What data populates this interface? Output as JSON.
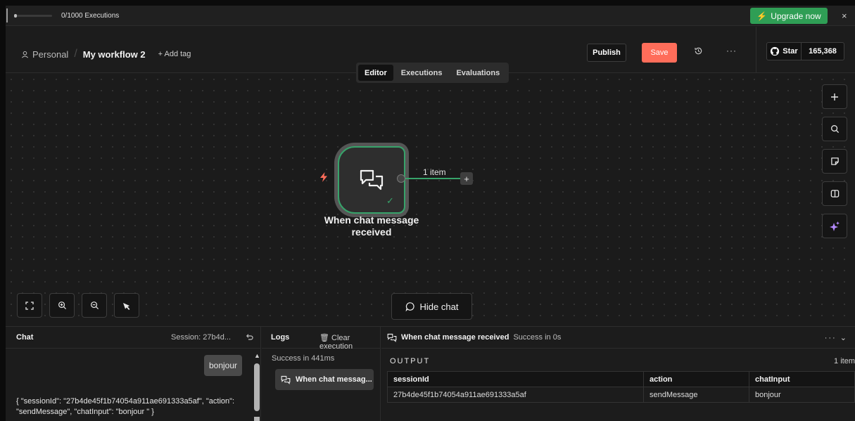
{
  "banner": {
    "executions": "0/1000 Executions",
    "upgrade_label": "Upgrade now",
    "close": "×"
  },
  "header": {
    "project": "Personal",
    "separator": "/",
    "workflow_name": "My workflow 2",
    "add_tag": "+ Add tag",
    "publish_label": "Publish",
    "save_label": "Save",
    "more": "···",
    "github_star_label": "Star",
    "github_star_count": "165,368"
  },
  "tabs": [
    {
      "label": "Editor",
      "active": true
    },
    {
      "label": "Executions",
      "active": false
    },
    {
      "label": "Evaluations",
      "active": false
    }
  ],
  "canvas": {
    "node_title": "When chat message received",
    "edge_label": "1 item",
    "hide_chat_label": "Hide chat",
    "right_tools": [
      "plus-icon",
      "search-icon",
      "sticky-note-icon",
      "panel-icon",
      "ai-sparkle-icon"
    ],
    "left_tools": [
      "fit-view-icon",
      "zoom-in-icon",
      "zoom-out-icon",
      "tidy-up-icon"
    ]
  },
  "chat": {
    "title": "Chat",
    "session": "Session: 27b4d...",
    "user_message": "bonjour",
    "response": "{ \"sessionId\": \"27b4de45f1b74054a911ae691333a5af\", \"action\": \"sendMessage\", \"chatInput\": \"bonjour \" }"
  },
  "logs": {
    "title": "Logs",
    "clear_execution": "Clear execution",
    "summary": "Success in 441ms",
    "item_label": "When chat messag..."
  },
  "output": {
    "node_name": "When chat message received",
    "status": "Success in 0s",
    "section_label": "OUTPUT",
    "item_count": "1 item",
    "columns": [
      "sessionId",
      "action",
      "chatInput"
    ],
    "rows": [
      [
        "27b4de45f1b74054a911ae691333a5af",
        "sendMessage",
        "bonjour"
      ]
    ]
  },
  "colors": {
    "accent_green": "#37a36a",
    "save_orange": "#ff6d5a",
    "upgrade_green": "#2f9e55"
  }
}
